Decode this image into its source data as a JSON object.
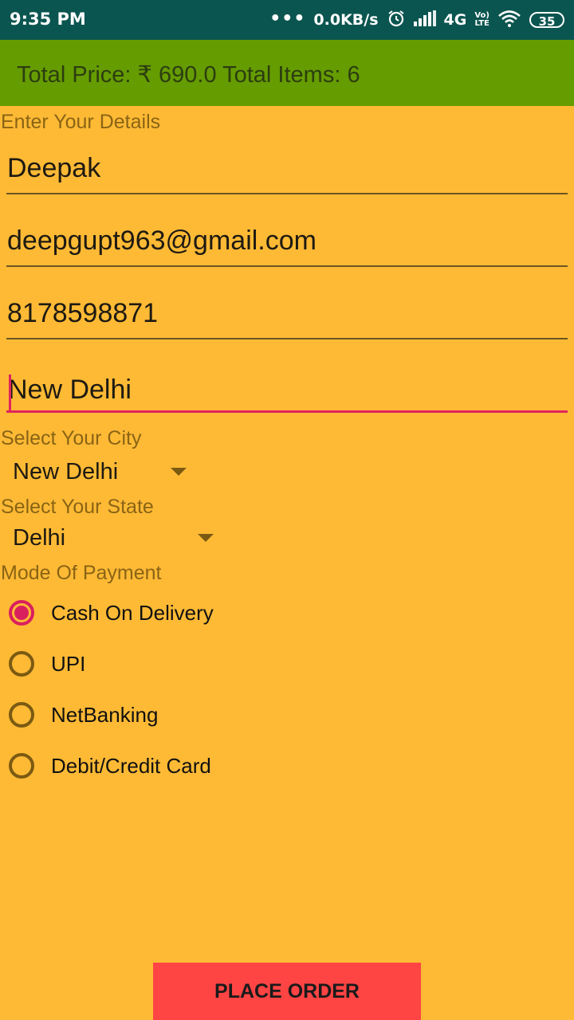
{
  "status_bar": {
    "time": "9:35 PM",
    "network_speed": "0.0KB/s",
    "network_type": "4G",
    "volte_label_top": "Vo)",
    "volte_label_bottom": "LTE",
    "battery": "35",
    "icons": [
      "more-dots-icon",
      "alarm-icon",
      "signal-icon",
      "wifi-icon",
      "battery-icon"
    ]
  },
  "header": {
    "summary": "Total Price: ₹ 690.0 Total Items: 6"
  },
  "details": {
    "title": "Enter Your Details",
    "name": "Deepak",
    "email": "deepgupt963@gmail.com",
    "phone": "8178598871",
    "address": "New Delhi"
  },
  "city": {
    "label": "Select Your City",
    "selected": "New Delhi"
  },
  "state": {
    "label": "Select Your State",
    "selected": "Delhi"
  },
  "payment": {
    "label": "Mode Of Payment",
    "options": [
      {
        "label": "Cash On Delivery",
        "checked": true
      },
      {
        "label": "UPI",
        "checked": false
      },
      {
        "label": "NetBanking",
        "checked": false
      },
      {
        "label": "Debit/Credit Card",
        "checked": false
      }
    ]
  },
  "actions": {
    "place_order": "PLACE ORDER"
  },
  "colors": {
    "status_bar": "#0B5550",
    "header": "#659C00",
    "background": "#FFBA35",
    "accent": "#E0245E",
    "button": "#FF4444"
  }
}
